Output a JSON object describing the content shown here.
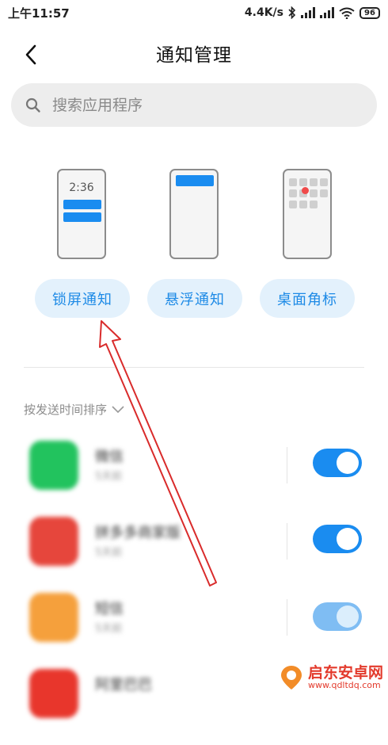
{
  "status_bar": {
    "time": "上午11:57",
    "network_speed": "4.4K/s",
    "battery": "96",
    "icons": [
      "bluetooth-icon",
      "signal-icon",
      "signal-icon",
      "wifi-icon",
      "battery-icon"
    ]
  },
  "header": {
    "title": "通知管理",
    "back_icon": "chevron-left-icon"
  },
  "search": {
    "placeholder": "搜索应用程序",
    "icon": "search-icon"
  },
  "notification_styles": {
    "lockscreen_preview_time": "2:36",
    "buttons": [
      {
        "label": "锁屏通知"
      },
      {
        "label": "悬浮通知"
      },
      {
        "label": "桌面角标"
      }
    ]
  },
  "sort": {
    "label": "按发送时间排序",
    "icon": "chevron-down-icon"
  },
  "apps": [
    {
      "name": "微信",
      "subtitle": "5天前",
      "icon_color": "#22c35e",
      "enabled": true
    },
    {
      "name": "拼多多商家版",
      "subtitle": "5天前",
      "icon_color": "#e6463c",
      "enabled": true
    },
    {
      "name": "短信",
      "subtitle": "5天前",
      "icon_color": "#f5a03c",
      "enabled": true
    },
    {
      "name": "阿里巴巴",
      "subtitle": "",
      "icon_color": "#e8362c",
      "enabled": true
    }
  ],
  "colors": {
    "accent": "#1a8cf0",
    "annotation_arrow": "#d92b2b"
  },
  "watermark": {
    "title": "启东安卓网",
    "url": "www.qdltdq.com"
  }
}
